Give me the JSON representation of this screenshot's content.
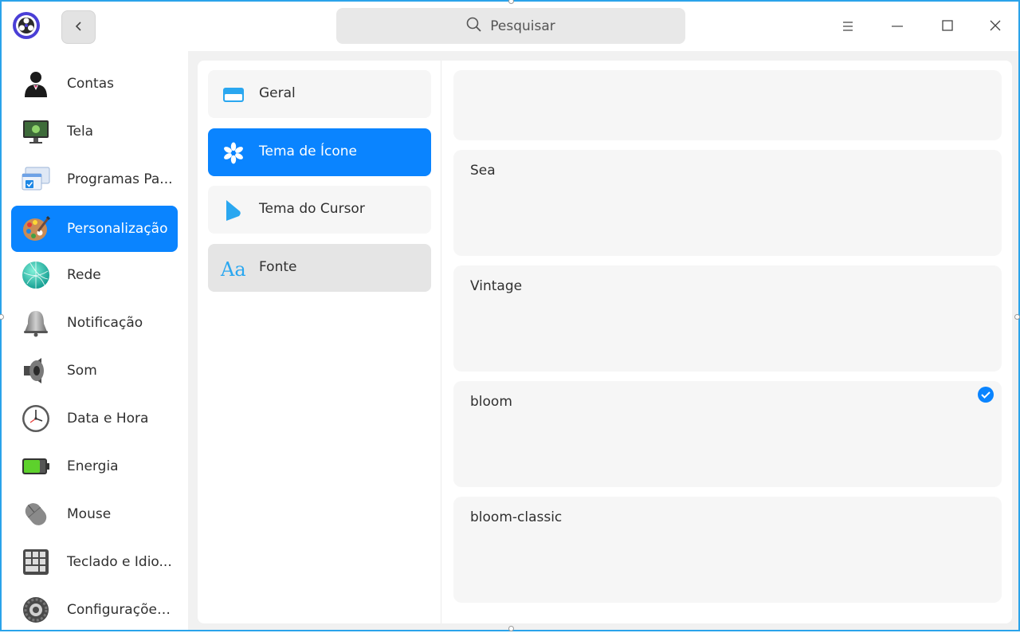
{
  "titlebar": {
    "search_placeholder": "Pesquisar",
    "app_logo_icon": "deepin-control-center-icon",
    "back_icon": "chevron-left-icon",
    "menu_icon": "menu-icon",
    "minimize_icon": "minimize-icon",
    "maximize_icon": "maximize-icon",
    "close_icon": "close-icon"
  },
  "sidebar": {
    "items": [
      {
        "label": "Contas",
        "icon": "accounts-icon"
      },
      {
        "label": "Tela",
        "icon": "display-icon"
      },
      {
        "label": "Programas Pa...",
        "icon": "default-applications-icon"
      },
      {
        "label": "Personalização",
        "icon": "personalization-icon",
        "active": true
      },
      {
        "label": "Rede",
        "icon": "network-icon"
      },
      {
        "label": "Notificação",
        "icon": "notification-bell-icon"
      },
      {
        "label": "Som",
        "icon": "sound-speaker-icon"
      },
      {
        "label": "Data e Hora",
        "icon": "clock-icon"
      },
      {
        "label": "Energia",
        "icon": "battery-icon"
      },
      {
        "label": "Mouse",
        "icon": "mouse-icon"
      },
      {
        "label": "Teclado e Idio...",
        "icon": "keyboard-icon"
      },
      {
        "label": "Configurações...",
        "icon": "gear-icon"
      }
    ]
  },
  "subnav": {
    "items": [
      {
        "label": "Geral",
        "icon": "window-icon"
      },
      {
        "label": "Tema de Ícone",
        "icon": "flower-icon",
        "active": true
      },
      {
        "label": "Tema do Cursor",
        "icon": "cursor-icon"
      },
      {
        "label": "Fonte",
        "icon": "font-icon",
        "hover": true
      }
    ]
  },
  "themes": [
    {
      "name": ""
    },
    {
      "name": "Sea"
    },
    {
      "name": "Vintage"
    },
    {
      "name": "bloom",
      "selected": true
    },
    {
      "name": "bloom-classic"
    }
  ],
  "colors": {
    "accent": "#0a84ff",
    "window_border": "#2aa3ea"
  }
}
